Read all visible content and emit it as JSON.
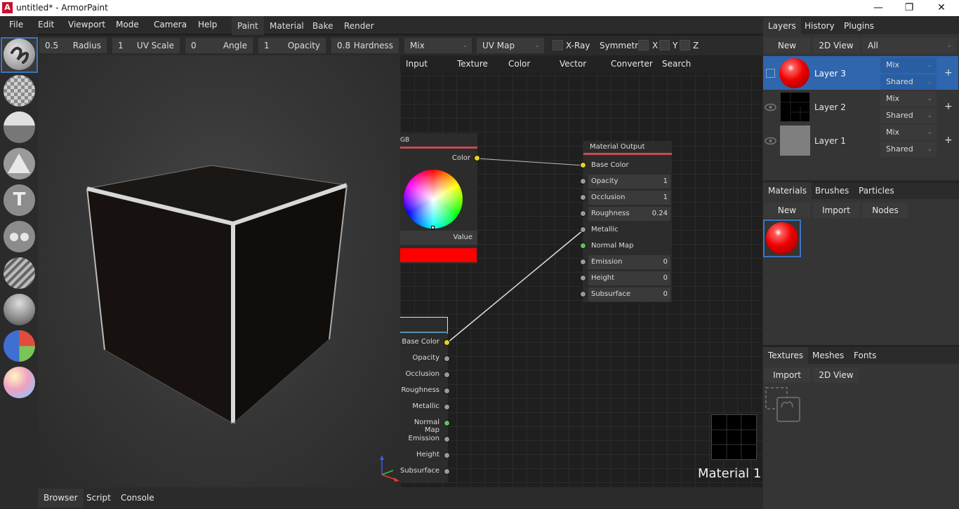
{
  "window": {
    "title": "untitled* - ArmorPaint",
    "logo_letter": "A",
    "minimize": "—",
    "maximize": "❐",
    "close": "✕"
  },
  "menubar": {
    "items": [
      "File",
      "Edit",
      "Viewport",
      "Mode",
      "Camera",
      "Help"
    ]
  },
  "workspace_tabs": [
    "Paint",
    "Material",
    "Bake",
    "Render"
  ],
  "toolbar": {
    "radius": {
      "value": "0.5",
      "label": "Radius"
    },
    "uv_scale": {
      "value": "1",
      "label": "UV Scale"
    },
    "angle": {
      "value": "0",
      "label": "Angle"
    },
    "opacity": {
      "value": "1",
      "label": "Opacity"
    },
    "hardness": {
      "value": "0.8",
      "label": "Hardness"
    },
    "blend": "Mix",
    "texcoord": "UV Map",
    "xray": "X-Ray",
    "symmetry": "Symmetry",
    "sym_x": "X",
    "sym_y": "Y",
    "sym_z": "Z"
  },
  "left_tools": [
    "brush-tool-icon",
    "eraser-tool-icon",
    "fill-tool-icon",
    "decal-tool-icon",
    "text-tool-icon",
    "clone-tool-icon",
    "blur-tool-icon",
    "particle-tool-icon",
    "colorid-tool-icon",
    "picker-tool-icon"
  ],
  "node_menu": [
    "Input",
    "Texture",
    "Color",
    "Vector",
    "Converter",
    "Search"
  ],
  "rgb_node": {
    "title": "GB",
    "output": "Color",
    "value_label": "Value",
    "color": "#ff0000"
  },
  "output_node": {
    "title": "Material Output",
    "inputs": [
      {
        "label": "Base Color",
        "value": ""
      },
      {
        "label": "Opacity",
        "value": "1"
      },
      {
        "label": "Occlusion",
        "value": "1"
      },
      {
        "label": "Roughness",
        "value": "0.24"
      },
      {
        "label": "Metallic",
        "value": ""
      },
      {
        "label": "Normal Map",
        "value": ""
      },
      {
        "label": "Emission",
        "value": "0"
      },
      {
        "label": "Height",
        "value": "0"
      },
      {
        "label": "Subsurface",
        "value": "0"
      }
    ]
  },
  "partial_node": {
    "inputs": [
      "Base Color",
      "Opacity",
      "Occlusion",
      "Roughness",
      "Metallic",
      "Normal Map",
      "Emission",
      "Height",
      "Subsurface"
    ]
  },
  "material_name": "Material 1",
  "bottom_tabs": [
    "Browser",
    "Script",
    "Console"
  ],
  "layers_panel": {
    "tabs": [
      "Layers",
      "History",
      "Plugins"
    ],
    "new_label": "New",
    "view_label": "2D View",
    "filter": "All",
    "layers": [
      {
        "name": "Layer 3",
        "blend": "Mix",
        "mask": "Shared",
        "selected": true
      },
      {
        "name": "Layer 2",
        "blend": "Mix",
        "mask": "Shared",
        "selected": false
      },
      {
        "name": "Layer 1",
        "blend": "Mix",
        "mask": "Shared",
        "selected": false
      }
    ],
    "plus": "+"
  },
  "materials_panel": {
    "tabs": [
      "Materials",
      "Brushes",
      "Particles"
    ],
    "buttons": [
      "New",
      "Import",
      "Nodes"
    ]
  },
  "textures_panel": {
    "tabs": [
      "Textures",
      "Meshes",
      "Fonts"
    ],
    "buttons": [
      "Import",
      "2D View"
    ]
  },
  "colors": {
    "accent": "#3b74c2",
    "selected_layer": "#2f66ad",
    "red": "#ff0000",
    "node_header_line": "#c94a55"
  }
}
